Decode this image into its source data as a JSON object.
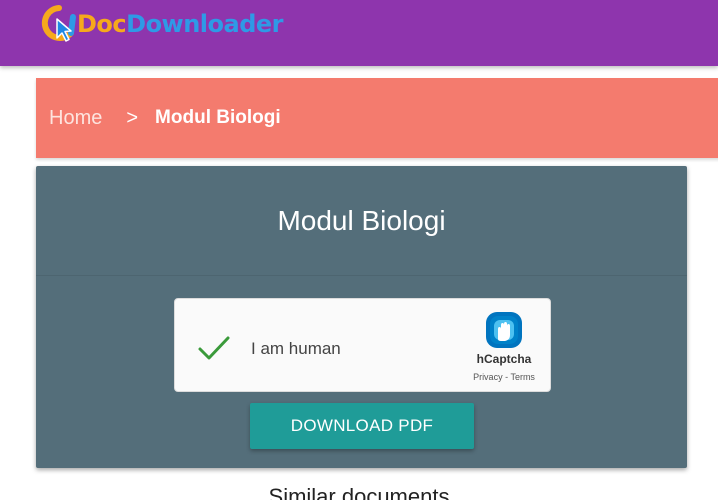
{
  "header": {
    "logo": {
      "icon": "logo-icon",
      "text_doc": "Doc",
      "text_downloader": "Downloader"
    },
    "background_color": "#8e35ad"
  },
  "breadcrumb": {
    "home": "Home",
    "separator": ">",
    "current": "Modul Biologi",
    "background_color": "#f47b6e"
  },
  "card": {
    "title": "Modul Biologi",
    "background_color": "#546e7a",
    "captcha": {
      "checked": true,
      "check_icon": "checkmark-icon",
      "label": "I am human",
      "brand": "hCaptcha",
      "privacy": "Privacy",
      "links_separator": "-",
      "terms": "Terms"
    },
    "download_button": {
      "label": "DOWNLOAD PDF",
      "color": "#1f9c98"
    }
  },
  "below_card_text": "Similar documents"
}
